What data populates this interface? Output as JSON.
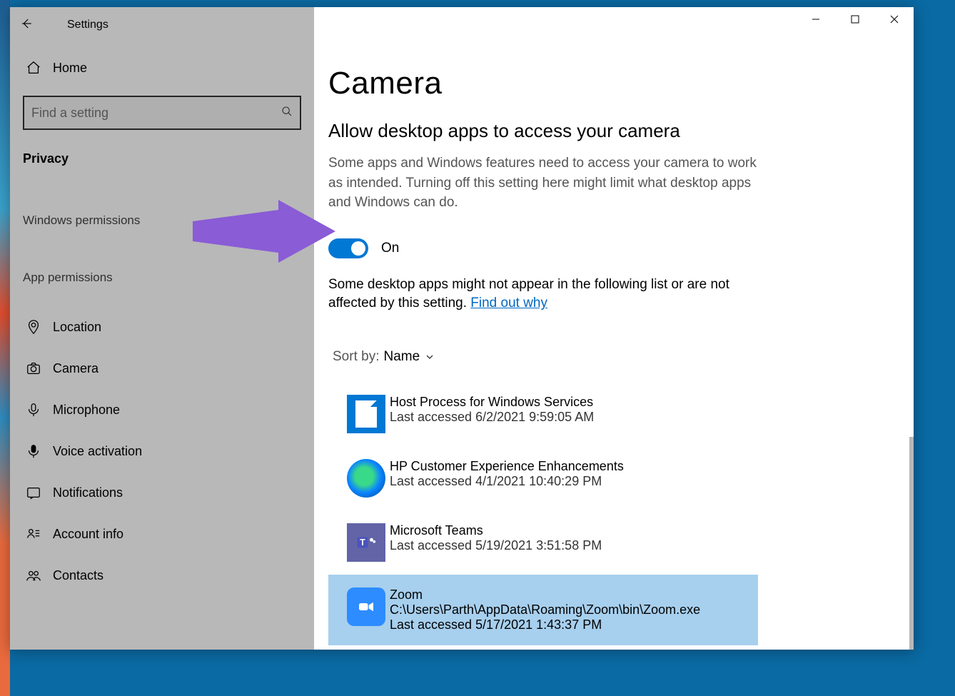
{
  "window": {
    "title": "Settings"
  },
  "sidebar": {
    "home": "Home",
    "search_placeholder": "Find a setting",
    "category": "Privacy",
    "group_win": "Windows permissions",
    "group_app": "App permissions",
    "items": [
      {
        "label": "Location"
      },
      {
        "label": "Camera"
      },
      {
        "label": "Microphone"
      },
      {
        "label": "Voice activation"
      },
      {
        "label": "Notifications"
      },
      {
        "label": "Account info"
      },
      {
        "label": "Contacts"
      }
    ]
  },
  "main": {
    "title": "Camera",
    "section_title": "Allow desktop apps to access your camera",
    "helper": "Some apps and Windows features need to access your camera to work as intended. Turning off this setting here might limit what desktop apps and Windows can do.",
    "toggle_state": "On",
    "note_pre": "Some desktop apps might not appear in the following list or are not affected by this setting. ",
    "note_link": "Find out why",
    "sort_label": "Sort by:",
    "sort_value": "Name",
    "apps": [
      {
        "name": "Host Process for Windows Services",
        "sub": "Last accessed 6/2/2021 9:59:05 AM",
        "icon": "doc"
      },
      {
        "name": "HP Customer Experience Enhancements",
        "sub": "Last accessed 4/1/2021 10:40:29 PM",
        "icon": "edge"
      },
      {
        "name": "Microsoft Teams",
        "sub": "Last accessed 5/19/2021 3:51:58 PM",
        "icon": "teams"
      },
      {
        "name": "Zoom",
        "path": "C:\\Users\\Parth\\AppData\\Roaming\\Zoom\\bin\\Zoom.exe",
        "sub": "Last accessed 5/17/2021 1:43:37 PM",
        "icon": "zoom",
        "selected": true
      }
    ]
  }
}
